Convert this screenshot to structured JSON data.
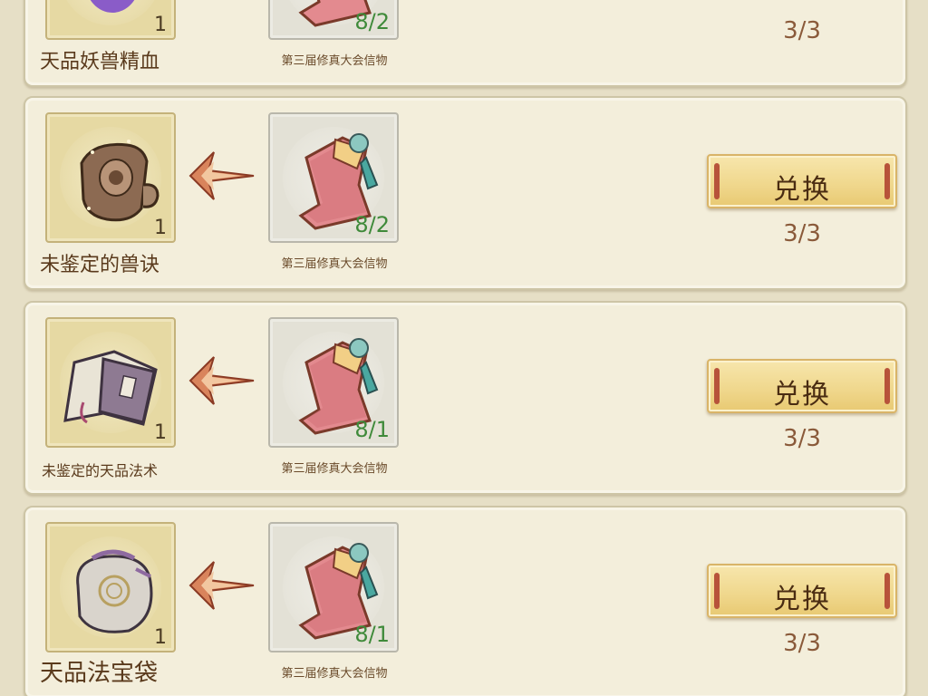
{
  "rows": [
    {
      "item_name": "天品妖兽精血",
      "item_qty": "1",
      "item_icon": "purple-orb-icon",
      "cost_name": "第三届修真大会信物",
      "cost_qty": "8/2",
      "cost_icon": "token-scroll-icon",
      "button_label": "",
      "limit": "3/3"
    },
    {
      "item_name": "未鉴定的兽诀",
      "item_qty": "1",
      "item_icon": "scroll-icon",
      "cost_name": "第三届修真大会信物",
      "cost_qty": "8/2",
      "cost_icon": "token-scroll-icon",
      "button_label": "兑换",
      "limit": "3/3"
    },
    {
      "item_name": "未鉴定的天品法术",
      "item_qty": "1",
      "item_icon": "book-icon",
      "cost_name": "第三届修真大会信物",
      "cost_qty": "8/1",
      "cost_icon": "token-scroll-icon",
      "button_label": "兑换",
      "limit": "3/3"
    },
    {
      "item_name": "天品法宝袋",
      "item_qty": "1",
      "item_icon": "treasure-bag-icon",
      "cost_name": "第三届修真大会信物",
      "cost_qty": "8/1",
      "cost_icon": "token-scroll-icon",
      "button_label": "兑换",
      "limit": "3/3"
    }
  ],
  "colors": {
    "button": "#f0d88e",
    "cost_qty": "#3f8a3a",
    "limit": "#8a5a3a",
    "panel": "#f3eedb"
  }
}
